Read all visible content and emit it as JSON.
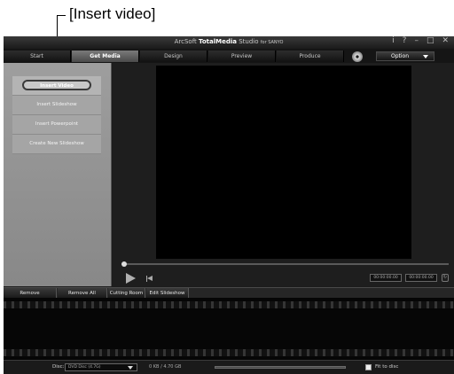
{
  "callout": {
    "label": "[Insert video]"
  },
  "titlebar": {
    "prefix": "ArcSoft",
    "brand": "TotalMedia",
    "suffix": " Studio",
    "by": "for SANYO",
    "info_label": "i",
    "help_label": "?",
    "minimize_label": "–",
    "maximize_label": "□",
    "close_label": "✕"
  },
  "tabs": [
    {
      "label": "Start"
    },
    {
      "label": "Get Media"
    },
    {
      "label": "Design"
    },
    {
      "label": "Preview"
    },
    {
      "label": "Produce"
    }
  ],
  "option_label": "Option",
  "menu": {
    "items": [
      {
        "label": "Insert Video",
        "selected": true
      },
      {
        "label": "Insert Slideshow"
      },
      {
        "label": "Insert Powerpoint"
      },
      {
        "label": "Create New Slideshow"
      }
    ]
  },
  "player": {
    "timecode_current": "00:00:00.00",
    "timecode_total": "00:00:00.00",
    "progress": 0
  },
  "toolbar": {
    "remove_label": "Remove",
    "remove_all_label": "Remove All",
    "cutting_room_label": "Cutting Room",
    "edit_slideshow_label": "Edit Slideshow"
  },
  "status": {
    "disc_label": "Disc:",
    "disc_value": "DVD Disc (4.7G)",
    "size_text": "0 KB / 4.70 GB",
    "capacity_used": 0,
    "fit_label": "Fit to disc"
  },
  "colors": {
    "app_background": "#1c1c1c",
    "left_panel": "#9e9e9e",
    "active_tab": "#6a6a6a"
  },
  "icons": [
    "disc-icon",
    "play-icon",
    "stop-icon",
    "loop-icon",
    "dropdown-caret-icon"
  ]
}
